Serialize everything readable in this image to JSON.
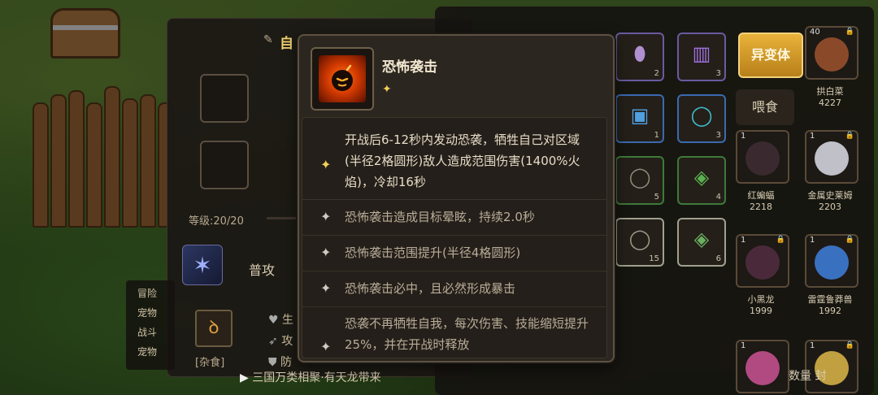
{
  "tooltip": {
    "title": "恐怖袭击",
    "star": "✦",
    "effects": [
      {
        "text": "开战后6-12秒内发动恐袭，牺牲自己对区域(半径2格圆形)敌人造成范围伤害(1400%火焰)，冷却16秒"
      },
      {
        "text": "恐怖袭击造成目标晕眩，持续2.0秒"
      },
      {
        "text": "恐怖袭击范围提升(半径4格圆形)"
      },
      {
        "text": "恐怖袭击必中，且必然形成暴击"
      },
      {
        "text": "恐袭不再牺牲自我，每次伤害、技能缩短提升25%，并在开战时释放"
      }
    ]
  },
  "hero_panel": {
    "title_fragment": "自",
    "level": "等级:20/20",
    "skill_tab": "普攻",
    "food_label": "[杂食]",
    "stats": [
      "生",
      "攻",
      "防"
    ],
    "notes": [
      "冒险",
      "宠物",
      "战斗",
      "宠物"
    ],
    "marquee": "三国万类相聚·有天龙带来"
  },
  "inventory": {
    "mutant_button": "异变体",
    "feed_button": "喂食",
    "cells": [
      {
        "count": "2"
      },
      {
        "count": "3"
      },
      {
        "count": "1"
      },
      {
        "count": "3"
      },
      {
        "count": "5"
      },
      {
        "count": "4"
      },
      {
        "count": "15"
      },
      {
        "count": "6"
      }
    ],
    "pets": [
      {
        "level": "40",
        "name": "拱白菜",
        "power": "4227"
      },
      {
        "level": "1",
        "name": "红蝙蝠",
        "power": "2218"
      },
      {
        "level": "1",
        "name": "金属史莱姆",
        "power": "2203"
      },
      {
        "level": "1",
        "name": "小黑龙",
        "power": "1999"
      },
      {
        "level": "1",
        "name": "雷霆鲁莽兽",
        "power": "1992"
      },
      {
        "level": "1",
        "name": "",
        "power": ""
      },
      {
        "level": "1",
        "name": "",
        "power": ""
      }
    ],
    "footer_text": "数量 封"
  },
  "colors": {
    "accent_gold": "#f2cf5a",
    "tooltip_bg": "#2c2620",
    "mutant_button": "#e8b23a"
  },
  "icons": [
    "bomb-skill-icon",
    "star-icon",
    "sparkle-icon",
    "lock-icon",
    "claw-icon",
    "ear-icon"
  ]
}
